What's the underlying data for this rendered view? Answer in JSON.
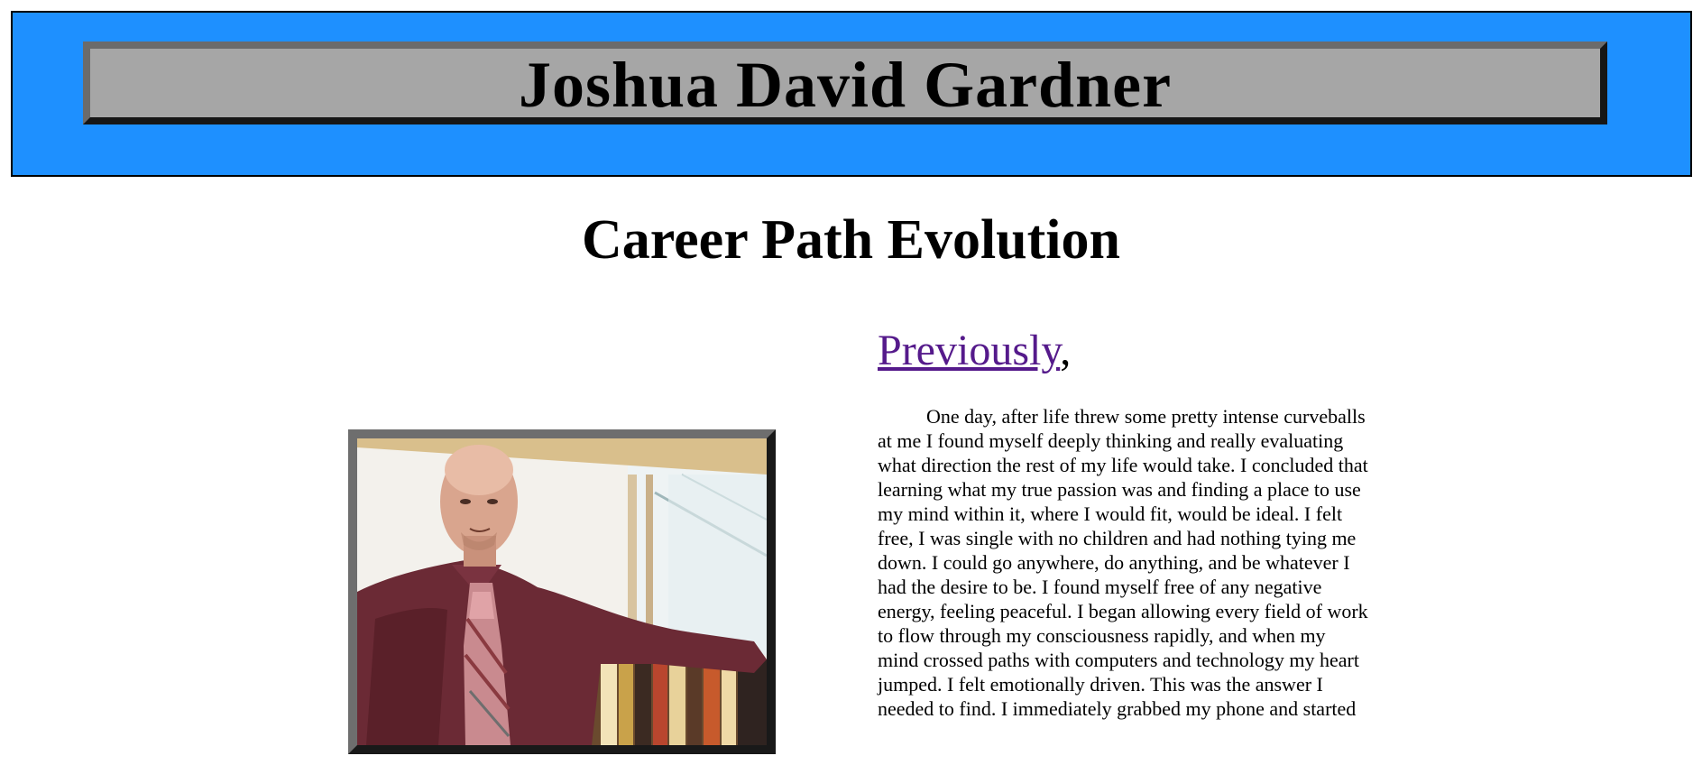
{
  "header": {
    "name": "Joshua David Gardner"
  },
  "page": {
    "title": "Career Path Evolution"
  },
  "section": {
    "link_text": "Previously",
    "link_suffix": ",",
    "paragraph": "One day, after life threw some pretty intense curveballs at me I found myself deeply thinking and really evaluating what direction the rest of my life would take. I concluded that learning what my true passion was and finding a place to use my mind within it, where I would fit, would be ideal. I felt free, I was single with no children and had nothing tying me down. I could go anywhere, do anything, and be whatever I had the desire to be. I found myself free of any negative energy, feeling peaceful. I began allowing every field of work to flow through my consciousness rapidly, and when my mind crossed paths with computers and technology my heart jumped. I felt emotionally driven. This was the answer I needed to find. I immediately grabbed my phone and started"
  },
  "colors": {
    "banner_background": "#1e90ff",
    "name_box_background": "#a6a6a6",
    "link_visited": "#551a8b"
  }
}
